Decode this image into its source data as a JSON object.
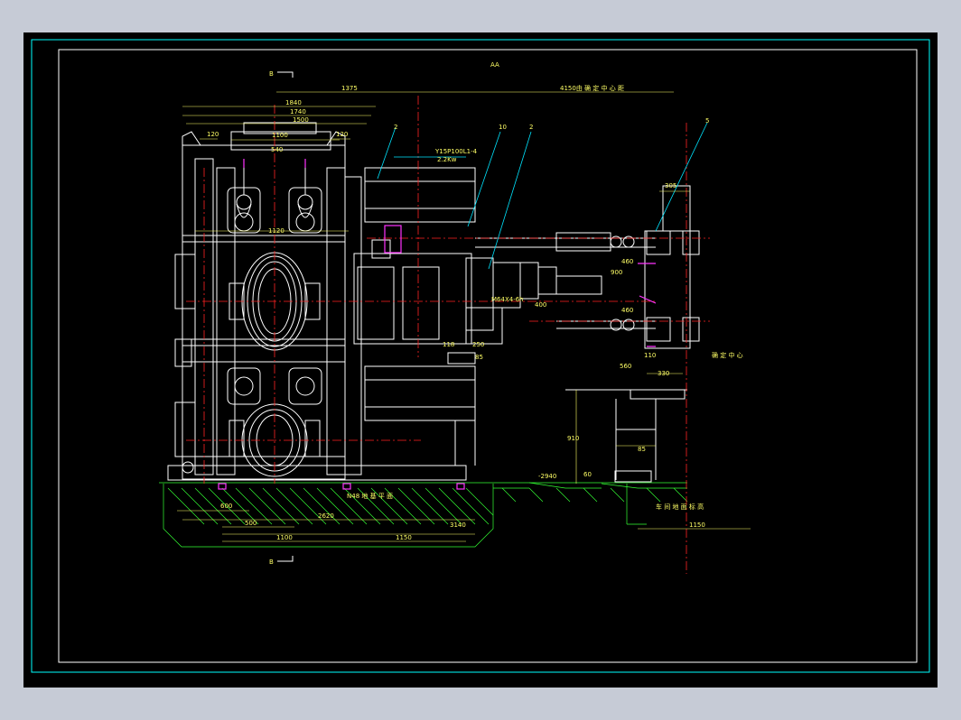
{
  "drawing": {
    "view_title": "AA",
    "section_top": "B",
    "section_bottom": "B",
    "motor_model": "Y15P100L1-4",
    "motor_power": "2.2Kw",
    "parts": [
      "2",
      "10",
      "2",
      "5"
    ],
    "note_top": "4150由 确 定 中 心 距",
    "note_right": "确 定 中 心",
    "note_floor": "N48 地 基 平 面",
    "note_floor_right": "车 间 地 面 标 高",
    "floor_level": "-2940",
    "dims": {
      "d1375": "1375",
      "d1840": "1840",
      "d1740": "1740",
      "d1500": "1500",
      "d1100": "1100",
      "d120a": "120",
      "d120b": "120",
      "d540": "540",
      "d1120": "1120",
      "d305": "305",
      "d900": "900",
      "d460": "460",
      "d460b": "460",
      "d400": "400",
      "d118": "118",
      "d250": "250",
      "d85a": "85",
      "d560": "560",
      "d110": "110",
      "d330": "330",
      "d910": "910",
      "d85b": "85",
      "d60": "60",
      "d600": "600",
      "d500": "500",
      "d2620": "2620",
      "d3140": "3140",
      "d1100b": "1100",
      "d1150a": "1150",
      "d1150b": "1150",
      "dM64": "M64X4-6h"
    }
  },
  "colors": {
    "frame_white": "#ffffff",
    "border_cyan": "#00ffff",
    "dim_yellow": "#ffff66",
    "center_red": "#ff2222",
    "accent_magenta": "#ff33ff",
    "leader_cyan": "#00e5ff",
    "hatch_green": "#33ff33"
  }
}
